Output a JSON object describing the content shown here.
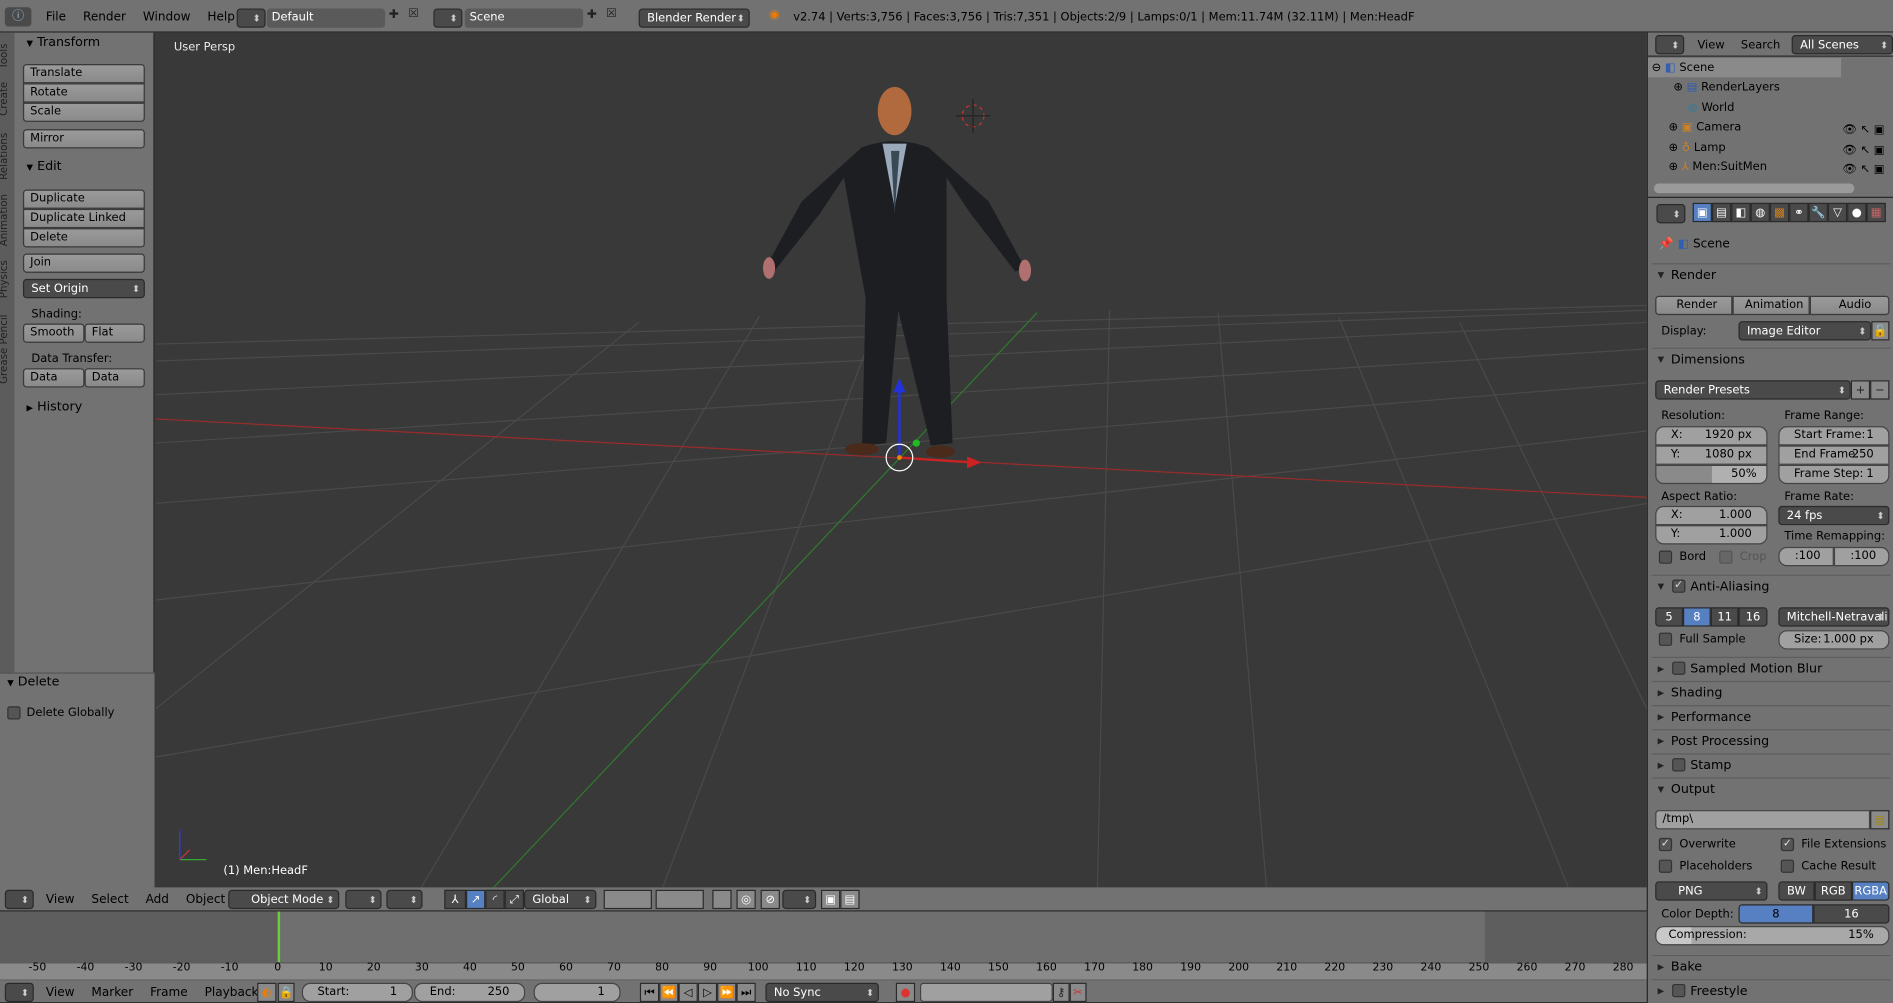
{
  "topbar": {
    "menus": [
      "File",
      "Render",
      "Window",
      "Help"
    ],
    "layout": "Default",
    "scene": "Scene",
    "engine": "Blender Render",
    "stats": "v2.74 | Verts:3,756 | Faces:3,756 | Tris:7,351 | Objects:2/9 | Lamps:0/1 | Mem:11.74M (32.11M) | Men:HeadF"
  },
  "tool_shelf": {
    "tabs": [
      "Tools",
      "Create",
      "Relations",
      "Animation",
      "Physics",
      "Grease Pencil"
    ],
    "transform": {
      "title": "Transform",
      "buttons": [
        "Translate",
        "Rotate",
        "Scale",
        "Mirror"
      ]
    },
    "edit": {
      "title": "Edit",
      "buttons": [
        "Duplicate",
        "Duplicate Linked",
        "Delete",
        "Join"
      ],
      "set_origin": "Set Origin",
      "shading_label": "Shading:",
      "smooth": "Smooth",
      "flat": "Flat",
      "data_transfer_label": "Data Transfer:",
      "data": "Data",
      "data_layout": "Data Layo"
    },
    "history": "History",
    "operator": {
      "title": "Delete",
      "delete_globally": "Delete Globally",
      "delete_globally_checked": false
    }
  },
  "viewport": {
    "view_label": "User Persp",
    "object_label": "(1) Men:HeadF"
  },
  "view3d_header": {
    "menus": [
      "View",
      "Select",
      "Add",
      "Object"
    ],
    "mode": "Object Mode",
    "orientation": "Global"
  },
  "timeline": {
    "ticks": [
      -50,
      -40,
      -30,
      -20,
      -10,
      0,
      10,
      20,
      30,
      40,
      50,
      60,
      70,
      80,
      90,
      100,
      110,
      120,
      130,
      140,
      150,
      160,
      170,
      180,
      190,
      200,
      210,
      220,
      230,
      240,
      250,
      260,
      270,
      280
    ],
    "current_frame": 1,
    "menus": [
      "View",
      "Marker",
      "Frame",
      "Playback"
    ],
    "start_label": "Start:",
    "start": "1",
    "end_label": "End:",
    "end": "250",
    "frame": "1",
    "sync": "No Sync"
  },
  "outliner": {
    "view": "View",
    "search": "Search",
    "filter": "All Scenes",
    "items": [
      "Scene",
      "RenderLayers",
      "World",
      "Camera",
      "Lamp",
      "Men:SuitMen"
    ]
  },
  "properties": {
    "context": "Scene",
    "render": {
      "title": "Render",
      "render": "Render",
      "animation": "Animation",
      "audio": "Audio",
      "display_label": "Display:",
      "display": "Image Editor"
    },
    "dimensions": {
      "title": "Dimensions",
      "presets": "Render Presets",
      "resolution_label": "Resolution:",
      "res_x_label": "X:",
      "res_x": "1920 px",
      "res_y_label": "Y:",
      "res_y": "1080 px",
      "res_pct": "50%",
      "res_pct_value": 50,
      "frame_range_label": "Frame Range:",
      "start_label": "Start Frame:",
      "start": "1",
      "end_label": "End Frame:",
      "end": "250",
      "step_label": "Frame Step:",
      "step": "1",
      "aspect_label": "Aspect Ratio:",
      "asp_x": "1.000",
      "asp_y": "1.000",
      "frame_rate_label": "Frame Rate:",
      "fps": "24 fps",
      "time_remap_label": "Time Remapping:",
      "remap_old": ":100",
      "remap_new": ":100",
      "border": "Bord",
      "crop": "Crop"
    },
    "anti_aliasing": {
      "title": "Anti-Aliasing",
      "enabled": true,
      "samples": [
        "5",
        "8",
        "11",
        "16"
      ],
      "selected": "8",
      "filter": "Mitchell-Netravali",
      "full_sample": "Full Sample",
      "size_label": "Size:",
      "size": "1.000 px"
    },
    "collapsed": [
      "Sampled Motion Blur",
      "Shading",
      "Performance",
      "Post Processing",
      "Stamp"
    ],
    "output": {
      "title": "Output",
      "path": "/tmp\\",
      "overwrite": "Overwrite",
      "file_extensions": "File Extensions",
      "placeholders": "Placeholders",
      "cache_result": "Cache Result",
      "format": "PNG",
      "color_modes": [
        "BW",
        "RGB",
        "RGBA"
      ],
      "color_mode": "RGBA",
      "depth_label": "Color Depth:",
      "depths": [
        "8",
        "16"
      ],
      "depth": "8",
      "compression_label": "Compression:",
      "compression": "15%",
      "compression_value": 15
    },
    "bake": "Bake",
    "freestyle": "Freestyle"
  },
  "colors": {
    "selected": "#5680c2",
    "timeline_cursor": "#6ad03a",
    "x_axis": "#c03030",
    "y_axis": "#3a9a3a"
  }
}
